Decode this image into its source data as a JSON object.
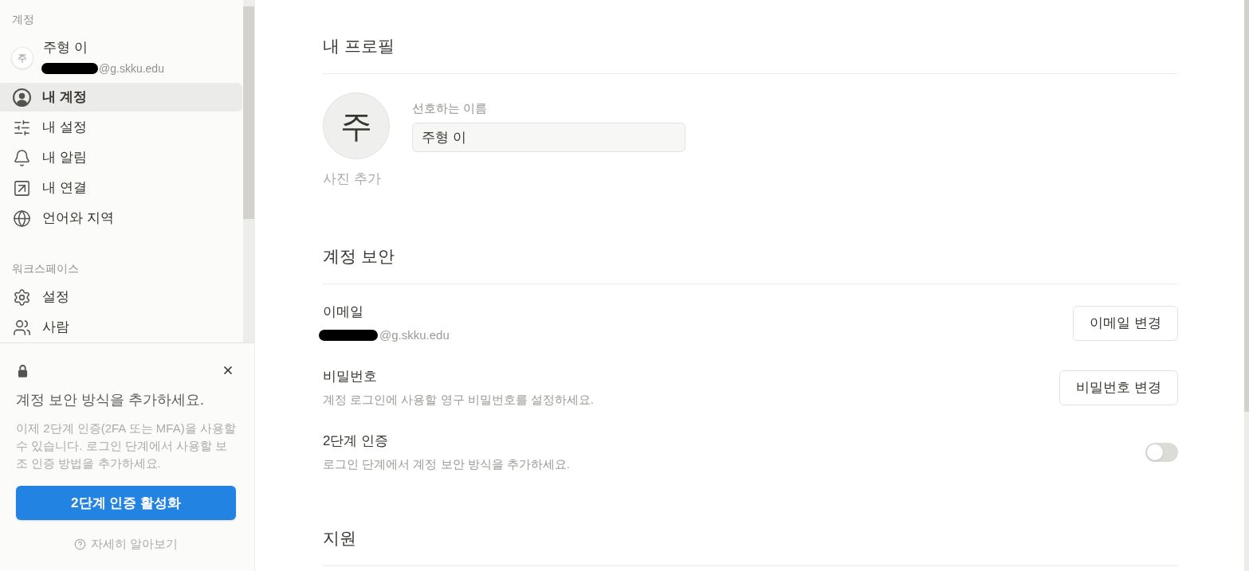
{
  "sidebar": {
    "account_label": "계정",
    "profile": {
      "initial": "주",
      "name": "주형 이",
      "email": "@g.skku.edu",
      "redacted": true
    },
    "account_items": [
      {
        "label": "내 계정",
        "selected": true
      },
      {
        "label": "내 설정",
        "selected": false
      },
      {
        "label": "내 알림",
        "selected": false
      },
      {
        "label": "내 연결",
        "selected": false
      },
      {
        "label": "언어와 지역",
        "selected": false
      }
    ],
    "workspace_label": "워크스페이스",
    "workspace_items": [
      {
        "label": "설정",
        "selected": false
      },
      {
        "label": "사람",
        "selected": false
      }
    ]
  },
  "security_prompt": {
    "title": "계정 보안 방식을 추가하세요.",
    "body": "이제 2단계 인증(2FA 또는 MFA)을 사용할 수 있습니다. 로그인 단계에서 사용할 보조 인증 방법을 추가하세요.",
    "button": "2단계 인증 활성화",
    "link": "자세히 알아보기"
  },
  "main": {
    "profile": {
      "title": "내 프로필",
      "avatar_initial": "주",
      "add_photo": "사진 추가",
      "name_label": "선호하는 이름",
      "name_value": "주형 이"
    },
    "security": {
      "title": "계정 보안",
      "rows": [
        {
          "kind": "button",
          "label": "이메일",
          "detail": "@g.skku.edu",
          "redacted": true,
          "button": "이메일 변경"
        },
        {
          "kind": "button",
          "label": "비밀번호",
          "detail": "계정 로그인에 사용할 영구 비밀번호를 설정하세요.",
          "button": "비밀번호 변경"
        },
        {
          "kind": "toggle",
          "label": "2단계 인증",
          "detail": "로그인 단계에서 계정 보안 방식을 추가하세요.",
          "on": false
        }
      ]
    },
    "support": {
      "title": "지원"
    }
  }
}
